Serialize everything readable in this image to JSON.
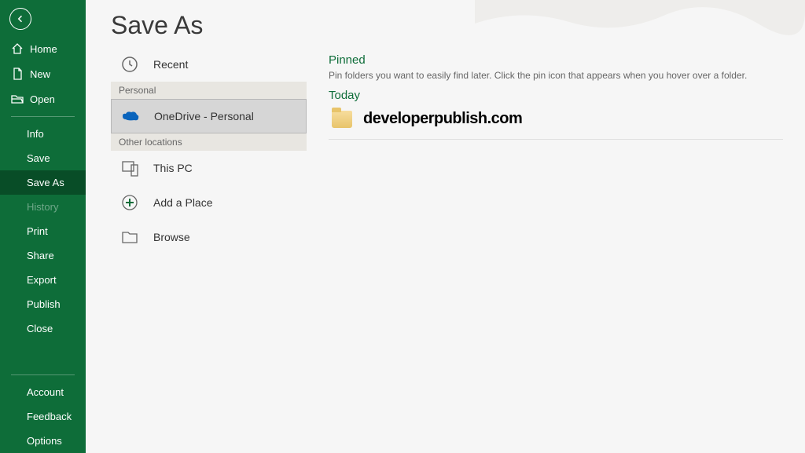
{
  "sidebar": {
    "back": "Back",
    "home": "Home",
    "new": "New",
    "open": "Open",
    "info": "Info",
    "save": "Save",
    "saveAs": "Save As",
    "history": "History",
    "print": "Print",
    "share": "Share",
    "export": "Export",
    "publish": "Publish",
    "close": "Close",
    "account": "Account",
    "feedback": "Feedback",
    "options": "Options"
  },
  "page": {
    "title": "Save As"
  },
  "locations": {
    "recent": "Recent",
    "personalHeader": "Personal",
    "onedrive": "OneDrive - Personal",
    "otherHeader": "Other locations",
    "thisPC": "This PC",
    "addPlace": "Add a Place",
    "browse": "Browse"
  },
  "right": {
    "pinnedTitle": "Pinned",
    "pinnedDesc": "Pin folders you want to easily find later. Click the pin icon that appears when you hover over a folder.",
    "todayTitle": "Today",
    "folderName": "developerpublish.com"
  }
}
